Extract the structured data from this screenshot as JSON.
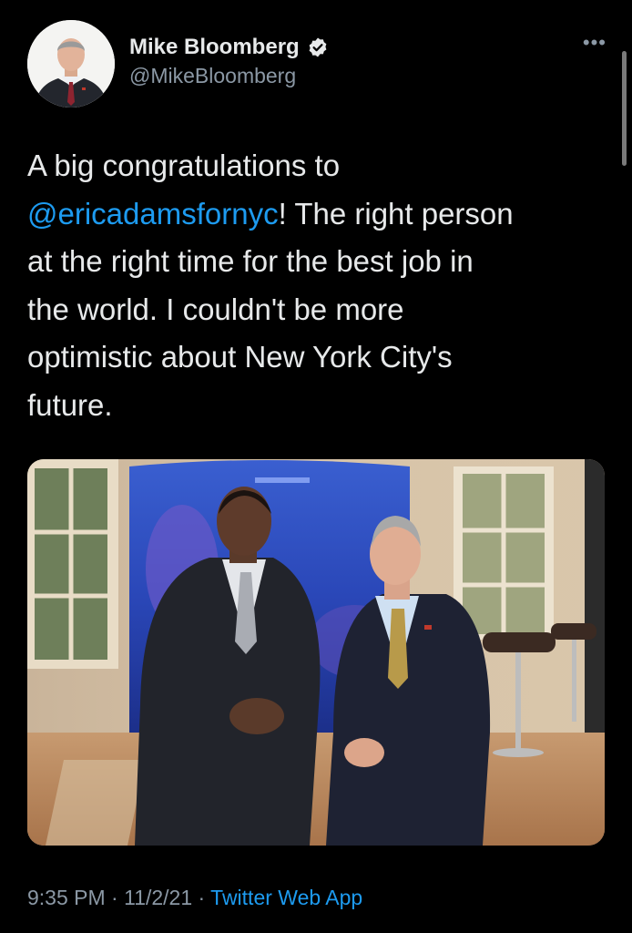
{
  "author": {
    "display_name": "Mike Bloomberg",
    "handle": "@MikeBloomberg",
    "verified": true,
    "verified_icon": "verified-badge-icon"
  },
  "tweet": {
    "text_before": "A big congratulations to\n",
    "mention": "@ericadamsfornyc",
    "text_after": "! The right person\nat the right time for the best job in\nthe world. I couldn't be more\noptimistic about New York City's\nfuture."
  },
  "meta": {
    "time": "9:35 PM",
    "sep1": " · ",
    "date": "11/2/21",
    "sep2": " · ",
    "source": "Twitter Web App"
  },
  "more_icon": "more-dots-icon",
  "colors": {
    "background": "#000000",
    "text": "#e7e9ea",
    "secondary": "#8b98a5",
    "link": "#1d9bf0"
  }
}
